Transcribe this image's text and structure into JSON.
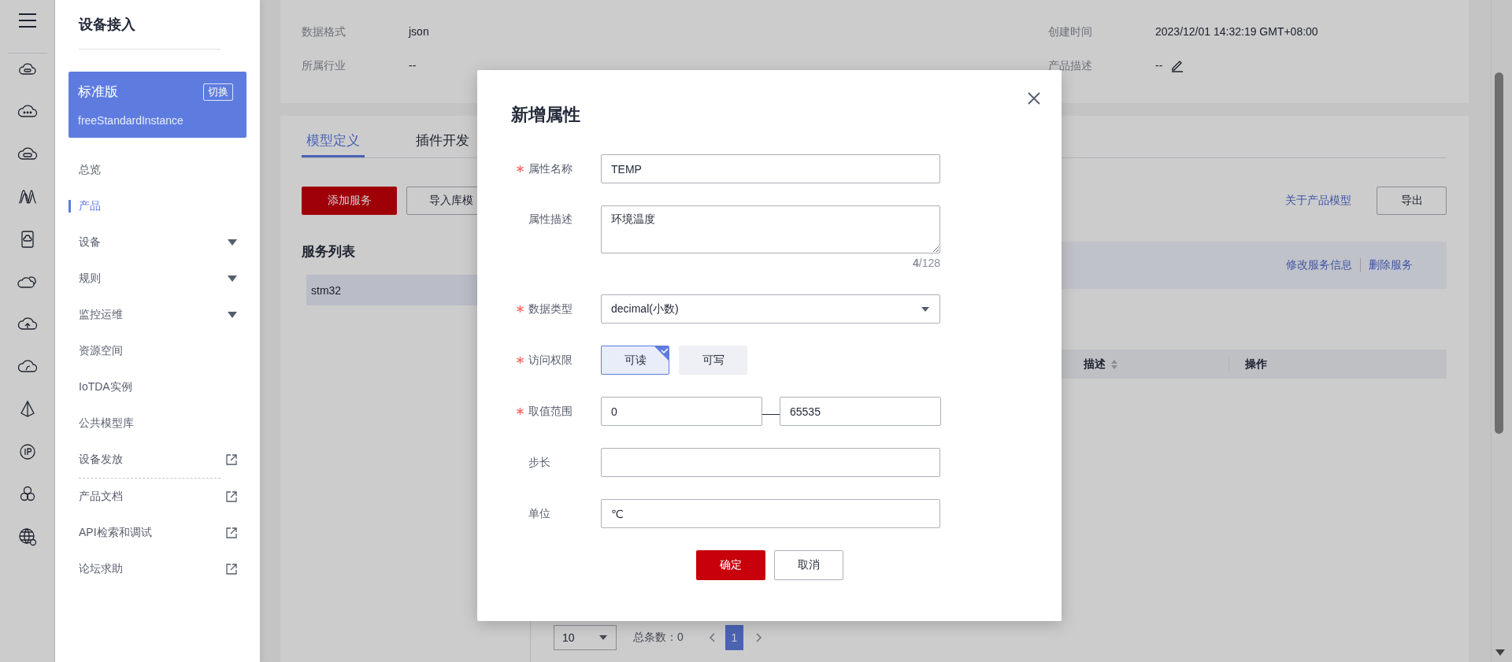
{
  "sidebar": {
    "title": "设备接入",
    "instance": {
      "edition": "标准版",
      "switch_label": "切换",
      "name": "freeStandardInstance"
    },
    "sections": [
      {
        "items": [
          {
            "label": "总览",
            "selected": false,
            "expandable": false,
            "external": false
          },
          {
            "label": "产品",
            "selected": true,
            "expandable": false,
            "external": false
          },
          {
            "label": "设备",
            "selected": false,
            "expandable": true,
            "external": false
          },
          {
            "label": "规则",
            "selected": false,
            "expandable": true,
            "external": false
          },
          {
            "label": "监控运维",
            "selected": false,
            "expandable": true,
            "external": false
          },
          {
            "label": "资源空间",
            "selected": false,
            "expandable": false,
            "external": false
          },
          {
            "label": "IoTDA实例",
            "selected": false,
            "expandable": false,
            "external": false
          },
          {
            "label": "公共模型库",
            "selected": false,
            "expandable": false,
            "external": false
          },
          {
            "label": "设备发放",
            "selected": false,
            "expandable": false,
            "external": true
          }
        ]
      },
      {
        "items": [
          {
            "label": "产品文档",
            "selected": false,
            "expandable": false,
            "external": true
          },
          {
            "label": "API检索和调试",
            "selected": false,
            "expandable": false,
            "external": true
          },
          {
            "label": "论坛求助",
            "selected": false,
            "expandable": false,
            "external": true
          }
        ]
      }
    ]
  },
  "product_info": {
    "columns": [
      {
        "fields": [
          {
            "label": "数据格式",
            "value": "json",
            "editable": false
          },
          {
            "label": "所属行业",
            "value": "--",
            "editable": false
          }
        ]
      },
      {
        "fields": [
          {
            "label": "创建时间",
            "value": "2023/12/01 14:32:19 GMT+08:00",
            "editable": false
          },
          {
            "label": "产品描述",
            "value": "--",
            "editable": true
          }
        ]
      }
    ]
  },
  "tabs": [
    {
      "label": "模型定义",
      "selected": true
    },
    {
      "label": "插件开发",
      "selected": false
    }
  ],
  "toolbar": {
    "add_button": "添加服务",
    "import_button": "导入库模",
    "link": "关于产品模型",
    "export_button": "导出"
  },
  "service_list": {
    "title": "服务列表",
    "items": [
      {
        "name": "stm32",
        "selected": true
      }
    ]
  },
  "service_actions": [
    "修改服务信息",
    "删除服务"
  ],
  "table": {
    "columns": [
      {
        "label": "描述",
        "sortable": true
      },
      {
        "label": "操作",
        "sortable": false
      }
    ]
  },
  "pagination": {
    "page_size": "10",
    "total": "总条数：0",
    "pages": [
      {
        "label": "1",
        "selected": true
      }
    ]
  },
  "dialog": {
    "title": "新增属性",
    "fields": [
      {
        "kind": "text",
        "label": "属性名称",
        "required": true,
        "value": "TEMP"
      },
      {
        "kind": "textarea",
        "label": "属性描述",
        "required": false,
        "value": "环境温度",
        "counter": "**4**/128"
      },
      {
        "kind": "select",
        "label": "数据类型",
        "required": true,
        "value": "decimal(小数)"
      },
      {
        "kind": "options",
        "label": "访问权限",
        "required": true,
        "options": [
          {
            "label": "可读",
            "selected": true
          },
          {
            "label": "可写",
            "selected": false
          }
        ]
      },
      {
        "kind": "range",
        "label": "取值范围",
        "required": true,
        "min": "0",
        "max": "65535"
      },
      {
        "kind": "text",
        "label": "步长",
        "required": false
      },
      {
        "kind": "text",
        "label": "单位",
        "required": false,
        "value": "℃"
      }
    ],
    "confirm_button": "确定",
    "cancel_button": "取消"
  }
}
